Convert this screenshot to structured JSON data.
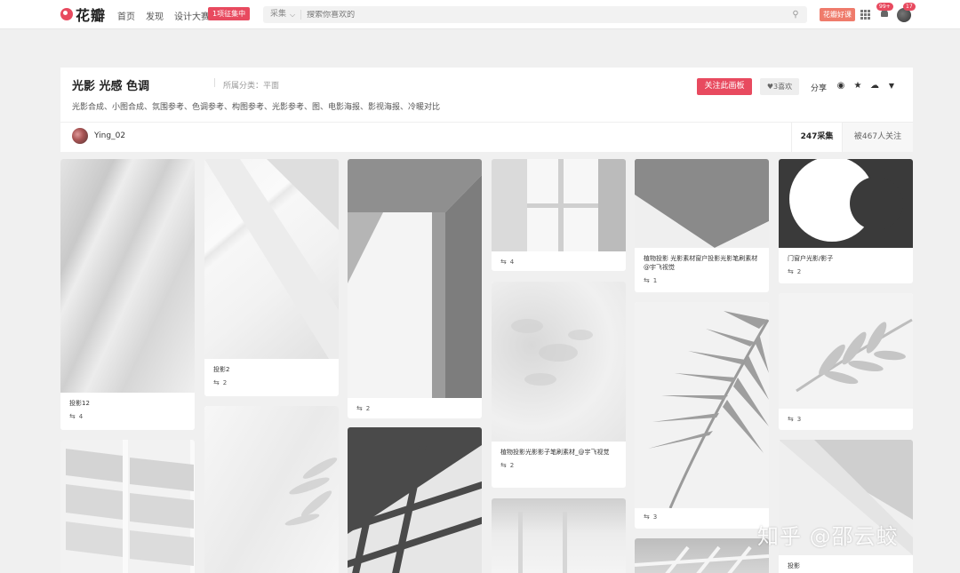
{
  "header": {
    "logo_text": "花瓣",
    "nav": [
      "首页",
      "发现",
      "设计大赛"
    ],
    "contest_badge": "1项征集中",
    "search": {
      "scope": "采集",
      "placeholder": "搜索你喜欢的"
    },
    "hot_button": "花瓣好课",
    "notify_count": "99+",
    "avatar_count": "17"
  },
  "board": {
    "title": "光影 光感 色调",
    "category": "所属分类：平面",
    "tags": "光影合成、小图合成、氛围参考、色调参考、构图参考、光影参考、图、电影海报、影视海报、冷暖对比",
    "follow_button": "关注此画板",
    "like_button": "3喜欢",
    "share_label": "分享",
    "owner_name": "Ying_02",
    "pins_count": "247采集",
    "followers": "被467人关注"
  },
  "pins": [
    {
      "caption": "投影12",
      "repins": "4"
    },
    {
      "caption": "投影2",
      "repins": "2"
    },
    {
      "caption": "",
      "repins": "2"
    },
    {
      "caption": "",
      "repins": "4"
    },
    {
      "caption": "植物投影 光影素材窗户投影光影笔刷素材 @宇飞视觉",
      "repins": "1"
    },
    {
      "caption": "门窗户光影/影子",
      "repins": "2"
    },
    {
      "caption": "植物投影光影影子笔刷素材_@宇飞视觉",
      "repins": "2"
    },
    {
      "caption": "",
      "repins": "3"
    },
    {
      "caption": "",
      "repins": "3"
    },
    {
      "caption": "投影",
      "repins": ""
    }
  ],
  "watermark": "知乎 @邵云蛟"
}
